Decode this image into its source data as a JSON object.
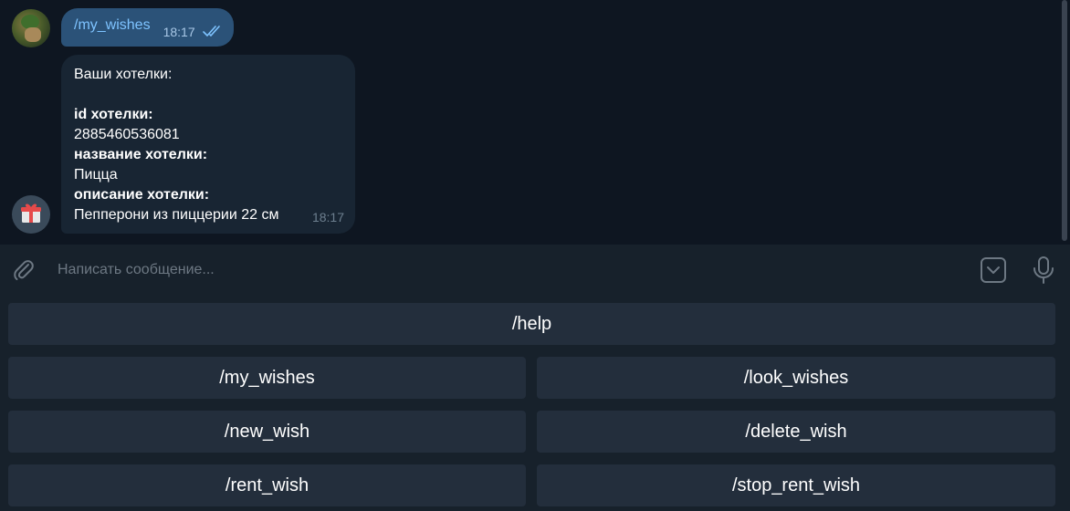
{
  "chat": {
    "outgoing": {
      "text": "/my_wishes",
      "time": "18:17"
    },
    "incoming": {
      "lines": [
        "Ваши хотелки:",
        "id хотелки:",
        "2885460536081",
        "название хотелки:",
        "Пицца",
        "описание хотелки:",
        "Пепперони из пиццерии 22 см"
      ],
      "time": "18:17"
    }
  },
  "composer": {
    "placeholder": "Написать сообщение..."
  },
  "keyboard": {
    "buttons": [
      "/help",
      "/my_wishes",
      "/look_wishes",
      "/new_wish",
      "/delete_wish",
      "/rent_wish",
      "/stop_rent_wish"
    ]
  },
  "colors": {
    "background": "#0e1621",
    "outgoing_bubble": "#2b5278",
    "incoming_bubble": "#182533",
    "panel": "#17212b",
    "button": "#232e3c",
    "link": "#7ec3ff"
  },
  "icons": [
    "user-avatar",
    "gift-icon",
    "double-check-icon",
    "paperclip-icon",
    "keyboard-icon",
    "microphone-icon"
  ]
}
